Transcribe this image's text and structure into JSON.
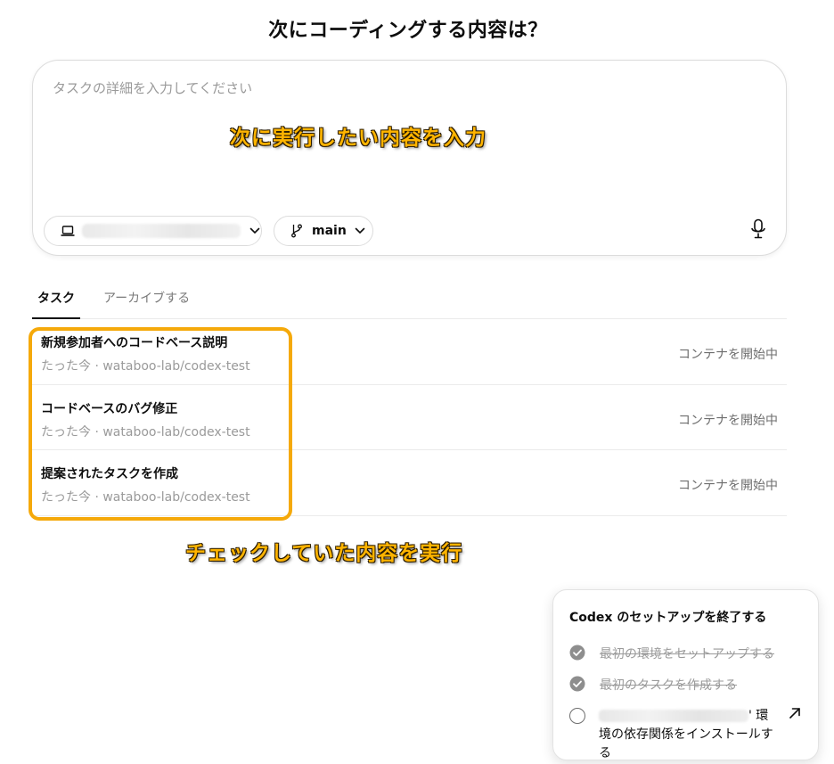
{
  "page": {
    "title": "次にコーディングする内容は？"
  },
  "composer": {
    "placeholder": "タスクの詳細を入力してください",
    "branch": "main",
    "icons": {
      "environment": "laptop-icon",
      "branch": "git-branch-icon",
      "mic": "microphone-icon",
      "chevron": "chevron-down-icon"
    }
  },
  "tabs": [
    {
      "label": "タスク",
      "active": true
    },
    {
      "label": "アーカイブする",
      "active": false
    }
  ],
  "tasks": [
    {
      "title": "新規参加者へのコードベース説明",
      "meta": "たった今 · wataboo-lab/codex-test",
      "status": "コンテナを開始中"
    },
    {
      "title": "コードベースのバグ修正",
      "meta": "たった今 · wataboo-lab/codex-test",
      "status": "コンテナを開始中"
    },
    {
      "title": "提案されたタスクを作成",
      "meta": "たった今 · wataboo-lab/codex-test",
      "status": "コンテナを開始中"
    }
  ],
  "annotations": {
    "top": "次に実行したい内容を入力",
    "bottom": "チェックしていた内容を実行"
  },
  "setup": {
    "title": "Codex のセットアップを終了する",
    "items": [
      {
        "label": "最初の環境をセットアップする",
        "done": true
      },
      {
        "label": "最初のタスクを作成する",
        "done": true
      },
      {
        "label_suffix": "' 環境の依存関係をインストールする",
        "done": false
      }
    ]
  },
  "colors": {
    "annotation": "#ffb400",
    "highlight": "#f5a90a",
    "muted": "#9a9a9a"
  }
}
